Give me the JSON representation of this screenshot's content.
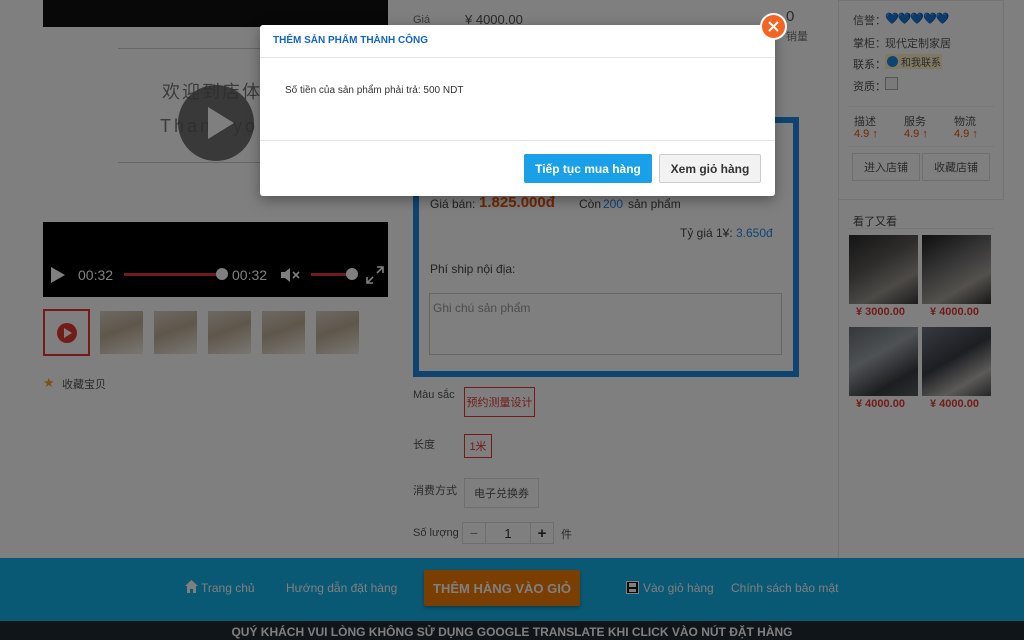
{
  "video": {
    "poster_line1": "欢迎到店体",
    "poster_line2": "Thank yo",
    "current_time": "00:32",
    "duration": "00:32",
    "progress": 1.0,
    "volume": 0.8
  },
  "gallery": {
    "thumb_count": 6
  },
  "favorite": {
    "label": "收藏宝贝"
  },
  "product": {
    "price_label": "Giá",
    "price_yen": "¥ 4000.00",
    "sales_count": "0",
    "sales_label": "销量",
    "sale_price_label": "Giá bán:",
    "sale_price": "1.825.000đ",
    "stock_label": "Còn",
    "stock": "200",
    "stock_unit": "sản phẩm",
    "rate_label": "Tỷ giá 1¥:",
    "rate": "3.650đ",
    "ship_label": "Phí ship nội địa:",
    "note_placeholder": "Ghi chú sản phẩm"
  },
  "options": {
    "color_label": "Màu sắc",
    "color_value": "预约测量设计",
    "length_label": "长度",
    "length_value": "1米",
    "consume_label": "消费方式",
    "consume_value": "电子兑换券",
    "qty_label": "Số lượng",
    "qty_minus": "−",
    "qty_value": "1",
    "qty_plus": "+",
    "qty_unit": "件"
  },
  "shop": {
    "credit_label": "信誉：",
    "credit_hearts": "💙💙💙💙💙",
    "type_label": "掌柜：",
    "type_value": "现代定制家居",
    "contact_label": "联系：",
    "contact_value": "和我联系",
    "qual_label": "资质：",
    "ratings": [
      {
        "label": "描述",
        "value": "4.9 ↑"
      },
      {
        "label": "服务",
        "value": "4.9 ↑"
      },
      {
        "label": "物流",
        "value": "4.9 ↑"
      }
    ],
    "enter_shop": "进入店铺",
    "fav_shop": "收藏店铺"
  },
  "see_also": {
    "title": "看了又看",
    "prices": [
      "¥ 3000.00",
      "¥ 4000.00",
      "¥ 4000.00",
      "¥ 4000.00"
    ]
  },
  "nav": {
    "home": "Trang chủ",
    "guide": "Hướng dẫn đặt hàng",
    "add_to_cart": "THÊM HÀNG VÀO GIỎ",
    "view_cart": "Vào giỏ hàng",
    "privacy": "Chính sách bảo mật"
  },
  "warning": "QUÝ KHÁCH VUI LÒNG KHÔNG SỬ DỤNG GOOGLE TRANSLATE KHI CLICK VÀO NÚT ĐẶT HÀNG",
  "modal": {
    "title": "THÊM SẢN PHẨM THÀNH CÔNG",
    "message": "Số tiền của sản phẩm phải trả: 500 NDT",
    "continue": "Tiếp tục mua hàng",
    "view_cart": "Xem giỏ hàng"
  },
  "colors": {
    "accent_blue": "#13b0e8",
    "accent_orange": "#f57c00",
    "price_orange": "#e65100",
    "close_orange": "#f26522"
  }
}
